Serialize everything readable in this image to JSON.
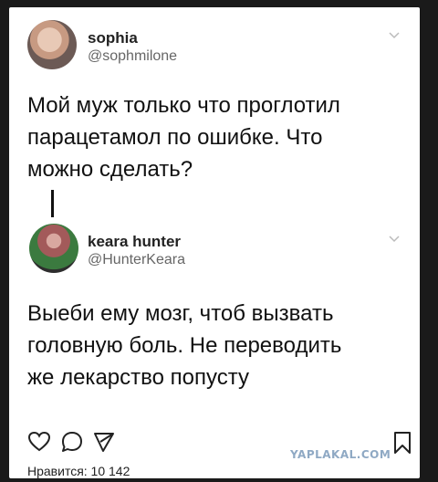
{
  "tweet1": {
    "name": "sophia",
    "handle": "@sophmilone",
    "lines": [
      "Мой муж только что проглотил",
      "парацетамол по ошибке. Что",
      "можно сделать?"
    ]
  },
  "tweet2": {
    "name": "keara hunter",
    "handle": "@HunterKeara",
    "lines": [
      "Выеби ему мозг, чтоб вызвать",
      "головную боль. Не переводить",
      "же лекарство попусту"
    ]
  },
  "icons": {
    "chevron": "chevron-down-icon",
    "like": "heart-icon",
    "comment": "comment-icon",
    "share": "send-icon",
    "save": "bookmark-icon"
  },
  "footer": {
    "likes_text": "Нравится: 10 142"
  },
  "watermark": "YAPLAKAL.COM"
}
